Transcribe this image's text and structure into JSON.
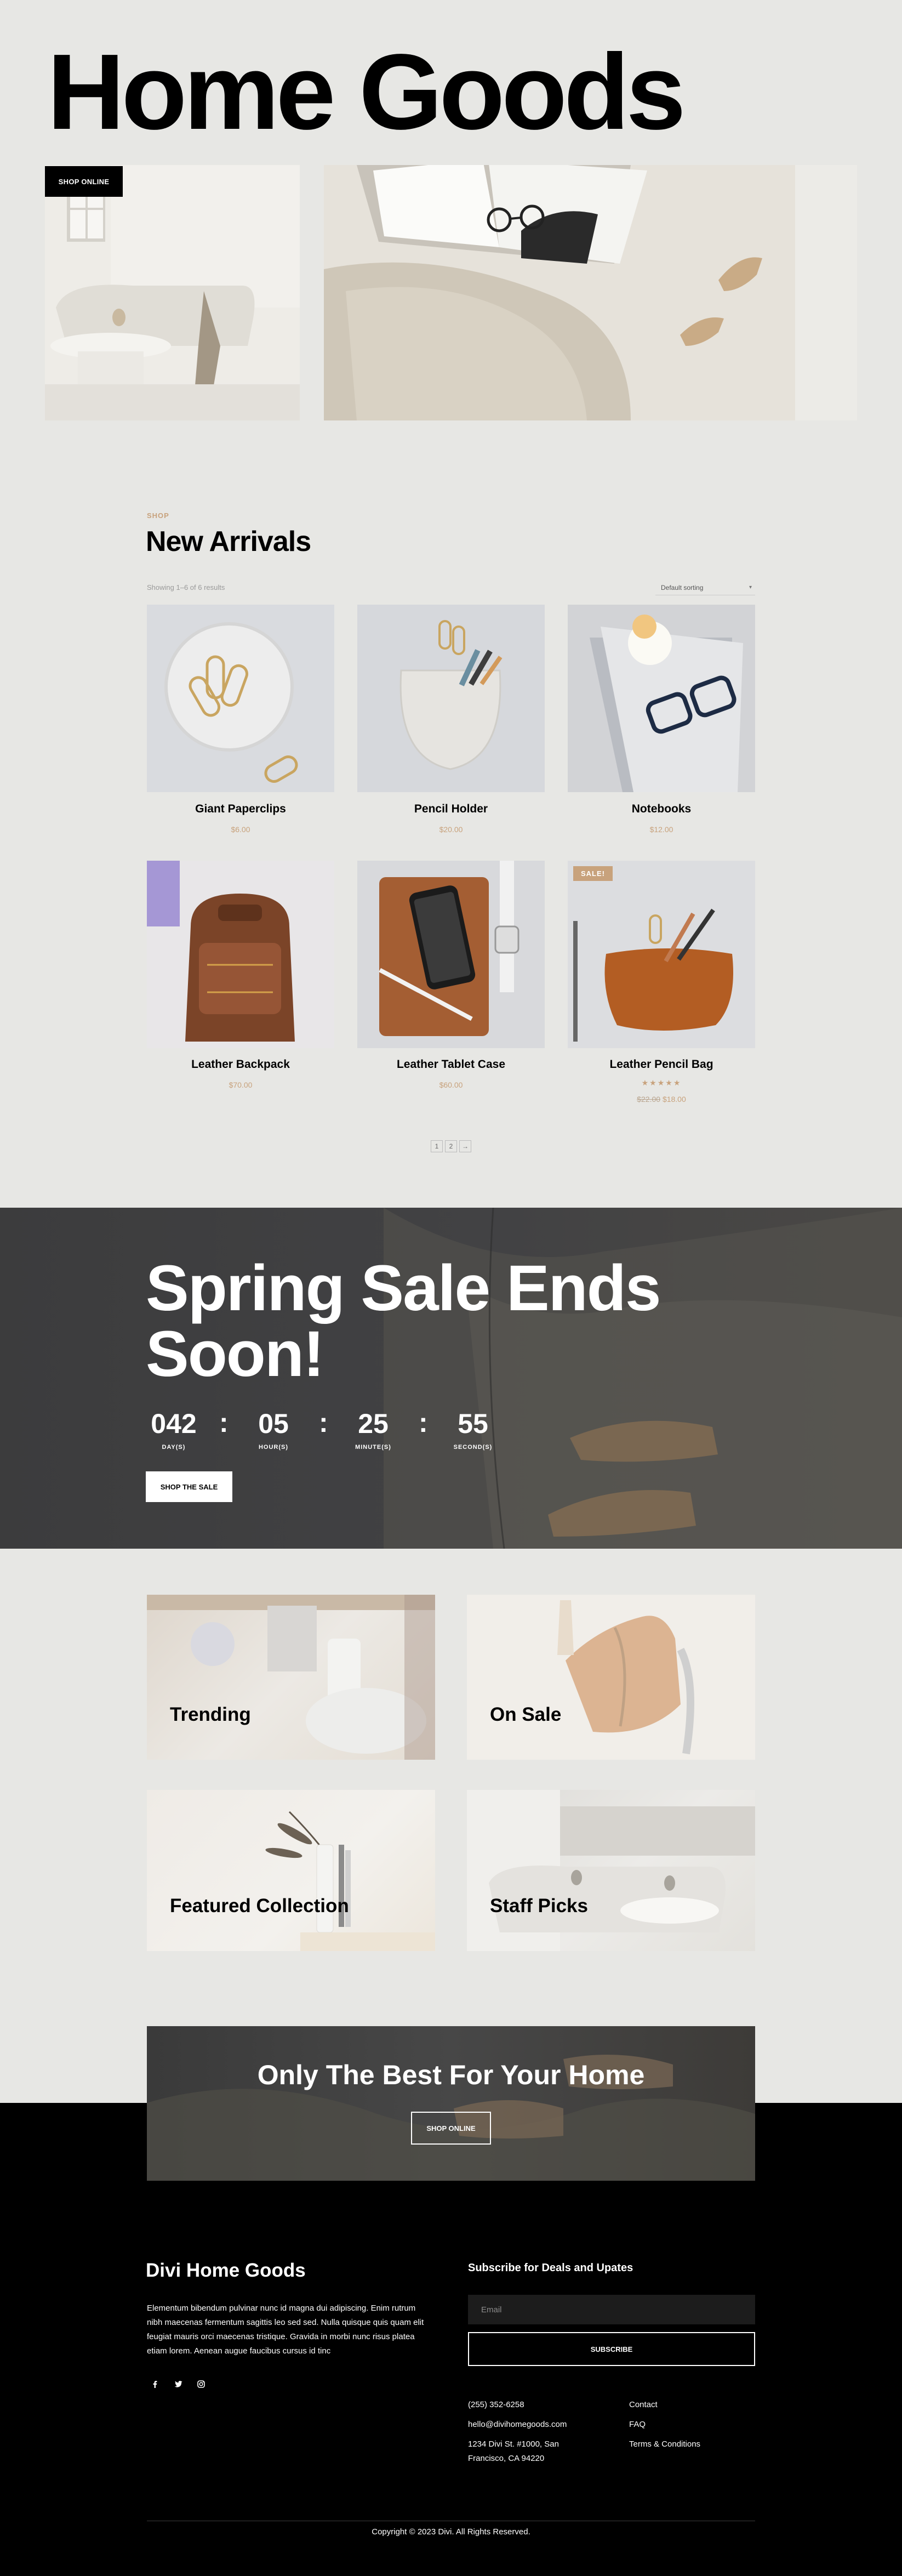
{
  "hero": {
    "title": "Home Goods",
    "shop_online_label": "SHOP ONLINE"
  },
  "shop": {
    "eyebrow": "SHOP",
    "title": "New Arrivals",
    "showing": "Showing 1–6 of 6 results",
    "sorting": "Default sorting",
    "products": [
      {
        "name": "Giant Paperclips",
        "price": "$6.00"
      },
      {
        "name": "Pencil Holder",
        "price": "$20.00"
      },
      {
        "name": "Notebooks",
        "price": "$12.00"
      },
      {
        "name": "Leather Backpack",
        "price": "$70.00"
      },
      {
        "name": "Leather Tablet Case",
        "price": "$60.00"
      },
      {
        "name": "Leather Pencil Bag",
        "old_price": "$22.00",
        "price": "$18.00",
        "badge": "SALE!",
        "rating": 5
      }
    ],
    "pagination": [
      "1",
      "2",
      "→"
    ]
  },
  "sale": {
    "title": "Spring Sale Ends Soon!",
    "countdown": [
      {
        "value": "042",
        "label": "DAY(S)"
      },
      {
        "value": "05",
        "label": "HOUR(S)"
      },
      {
        "value": "25",
        "label": "MINUTE(S)"
      },
      {
        "value": "55",
        "label": "SECOND(S)"
      }
    ],
    "separator": ":",
    "button": "SHOP THE SALE"
  },
  "categories": [
    {
      "label": "Trending"
    },
    {
      "label": "On Sale"
    },
    {
      "label": "Featured Collection"
    },
    {
      "label": "Staff Picks"
    }
  ],
  "cta": {
    "title": "Only The Best For Your Home",
    "button": "SHOP ONLINE"
  },
  "footer": {
    "brand": "Divi Home Goods",
    "about": "Elementum bibendum pulvinar nunc id magna dui adipiscing. Enim rutrum nibh maecenas fermentum sagittis leo sed sed. Nulla quisque quis quam elit feugiat mauris orci maecenas tristique. Gravida in morbi nunc risus platea etiam lorem. Aenean augue faucibus cursus id tinc",
    "social_icons": [
      "facebook-icon",
      "twitter-icon",
      "instagram-icon"
    ],
    "subscribe_title": "Subscribe for Deals and Upates",
    "email_placeholder": "Email",
    "subscribe_button": "SUBSCRIBE",
    "phone": "(255) 352-6258",
    "email": "hello@divihomegoods.com",
    "address": "1234 Divi St. #1000, San Francisco, CA 94220",
    "links": [
      "Contact",
      "FAQ",
      "Terms & Conditions"
    ],
    "copyright": "Copyright © 2023 Divi. All Rights Reserved."
  },
  "colors": {
    "background": "#e7e7e4",
    "accent": "#c8a27c",
    "dark": "#000000"
  }
}
